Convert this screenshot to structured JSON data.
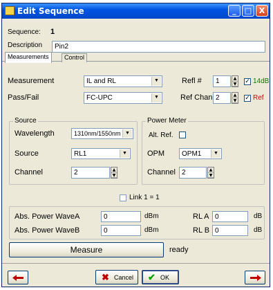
{
  "window": {
    "title": "Edit Sequence",
    "controls": [
      "_",
      "□",
      "X"
    ]
  },
  "sequence": {
    "label": "Sequence:",
    "value": "1"
  },
  "description": {
    "label": "Description",
    "value": "Pin2"
  },
  "tabs": [
    {
      "label": "Measurements",
      "active": true
    },
    {
      "label": "Control",
      "active": false
    }
  ],
  "measurement": {
    "label": "Measurement",
    "value": "IL and RL"
  },
  "passfail": {
    "label": "Pass/Fail",
    "value": "FC-UPC"
  },
  "refl": {
    "label": "Refl #",
    "value": "1",
    "check_label": "14dB",
    "check_color": "#008000",
    "checked": true
  },
  "refchan": {
    "label": "Ref Chan",
    "value": "2",
    "check_label": "Ref",
    "check_color": "#d00000",
    "checked": true
  },
  "source": {
    "group": "Source",
    "wavelength_label": "Wavelength",
    "wavelength_value": "1310nm/1550nm",
    "source_label": "Source",
    "source_value": "RL1",
    "channel_label": "Channel",
    "channel_value": "2"
  },
  "powermeter": {
    "group": "Power Meter",
    "altref_label": "Alt. Ref.",
    "opm_label": "OPM",
    "opm_value": "OPM1",
    "channel_label": "Channel",
    "channel_value": "2"
  },
  "link": {
    "label": "Link 1 = 1"
  },
  "results": {
    "abs_a_label": "Abs. Power WaveA",
    "abs_a_value": "0",
    "abs_a_unit": "dBm",
    "abs_b_label": "Abs. Power WaveB",
    "abs_b_value": "0",
    "abs_b_unit": "dBm",
    "rla_label": "RL A",
    "rla_value": "0",
    "rla_unit": "dB",
    "rlb_label": "RL B",
    "rlb_value": "0",
    "rlb_unit": "dB"
  },
  "measure": {
    "button": "Measure",
    "status": "ready"
  },
  "footer": {
    "cancel": "Cancel",
    "ok": "OK",
    "prev_icon": "left-arrow-icon",
    "next_icon": "right-arrow-icon"
  }
}
